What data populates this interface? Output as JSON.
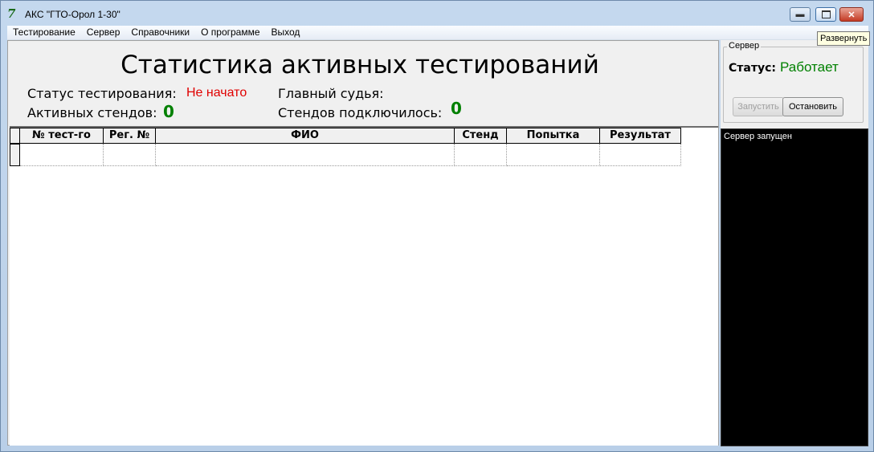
{
  "window": {
    "title": "АКС \"ГТО-Орол 1-30\"",
    "tooltip": "Развернуть"
  },
  "menu": [
    "Тестирование",
    "Сервер",
    "Справочники",
    "О программе",
    "Выход"
  ],
  "stats": {
    "title": "Статистика активных тестирований",
    "status_label": "Статус тестирования:",
    "status_value": "Не начато",
    "active_label": "Активных стендов:",
    "active_value": "0",
    "judge_label": "Главный судья:",
    "connected_label": "Стендов подключилось:",
    "connected_value": "0"
  },
  "table": {
    "columns": [
      "№ тест-го",
      "Рег. №",
      "ФИО",
      "Стенд",
      "Попытка",
      "Результат"
    ]
  },
  "server": {
    "group_title": "Сервер",
    "status_label": "Статус:",
    "status_value": "Работает",
    "start_label": "Запустить",
    "stop_label": "Остановить",
    "log": [
      "Сервер запущен"
    ]
  },
  "colors": {
    "status_not_started": "#e00000",
    "counter": "#008000",
    "server_running": "#008000"
  }
}
